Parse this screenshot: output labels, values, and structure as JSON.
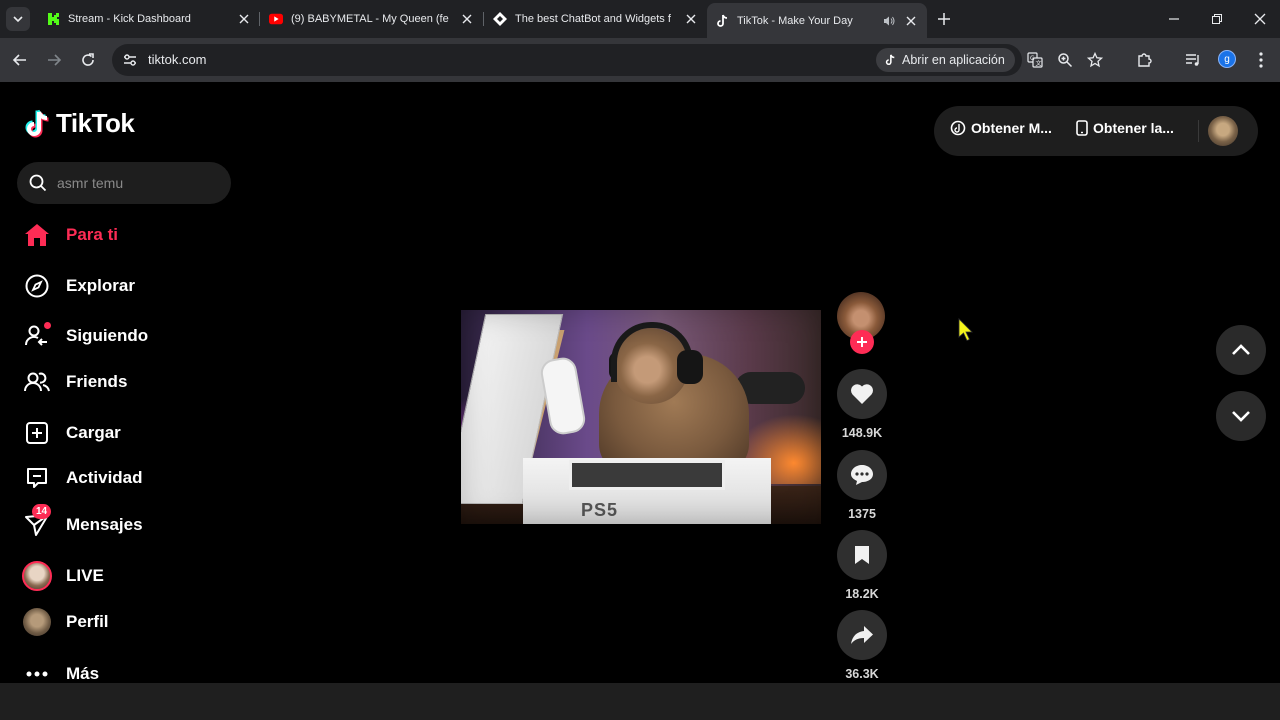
{
  "browser": {
    "tabs": [
      {
        "title": "Stream - Kick Dashboard"
      },
      {
        "title": "(9) BABYMETAL - My Queen (fe"
      },
      {
        "title": "The best ChatBot and Widgets f"
      },
      {
        "title": "TikTok - Make Your Day"
      }
    ],
    "url": "tiktok.com",
    "open_in_app": "Abrir en aplicación",
    "profile_initial": "g"
  },
  "tiktok": {
    "logo_text": "TikTok",
    "search_placeholder": "asmr temu",
    "nav": [
      {
        "label": "Para ti"
      },
      {
        "label": "Explorar"
      },
      {
        "label": "Siguiendo"
      },
      {
        "label": "Friends"
      },
      {
        "label": "Cargar"
      },
      {
        "label": "Actividad"
      },
      {
        "label": "Mensajes",
        "badge": "14"
      },
      {
        "label": "LIVE"
      },
      {
        "label": "Perfil"
      },
      {
        "label": "Más"
      }
    ],
    "top_buttons": {
      "coins": "Obtener M...",
      "app": "Obtener la..."
    },
    "video": {
      "box_text": "PS5",
      "likes": "148.9K",
      "comments": "1375",
      "saves": "18.2K",
      "shares": "36.3K"
    }
  },
  "colors": {
    "accent": "#fe2c55",
    "chrome_bg": "#202124",
    "toolbar_bg": "#35363a"
  }
}
